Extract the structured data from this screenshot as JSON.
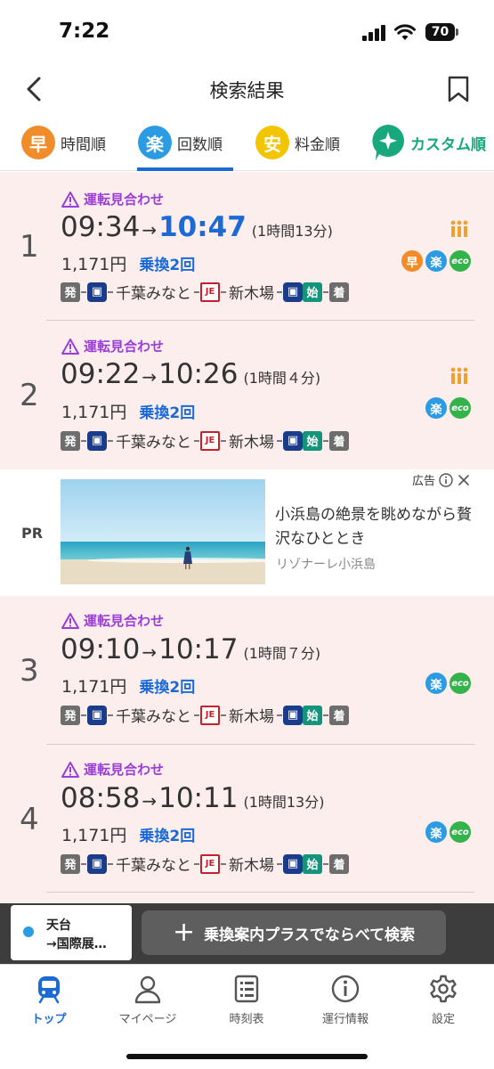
{
  "status_bar": {
    "time": "7:22",
    "battery": "70"
  },
  "header": {
    "title": "検索結果"
  },
  "tabs": [
    {
      "badge": "早",
      "label": "時間順",
      "color": "#f08c2a"
    },
    {
      "badge": "楽",
      "label": "回数順",
      "color": "#2b9be3"
    },
    {
      "badge": "安",
      "label": "料金順",
      "color": "#f2c500"
    },
    {
      "badge": "+",
      "label": "カスタム順",
      "color": "#17a87e"
    }
  ],
  "active_tab": "回数順",
  "results": [
    {
      "rank": "1",
      "notice": "運転見合わせ",
      "depart": "09:34",
      "arrow": "→",
      "arrive": "10:47",
      "duration": "(1時間13分)",
      "fare": "1,171円",
      "transfer": "乗換2回",
      "route": {
        "start": "発",
        "station1": "千葉みなと",
        "line": "JE",
        "station2": "新木場",
        "origin_mark": "始",
        "end": "着"
      },
      "tags": [
        "早",
        "楽",
        "eco"
      ]
    },
    {
      "rank": "2",
      "notice": "運転見合わせ",
      "depart": "09:22",
      "arrow": "→",
      "arrive": "10:26",
      "duration": "(1時間４分)",
      "fare": "1,171円",
      "transfer": "乗換2回",
      "route": {
        "start": "発",
        "station1": "千葉みなと",
        "line": "JE",
        "station2": "新木場",
        "origin_mark": "始",
        "end": "着"
      },
      "tags": [
        "楽",
        "eco"
      ]
    },
    {
      "rank": "3",
      "notice": "運転見合わせ",
      "depart": "09:10",
      "arrow": "→",
      "arrive": "10:17",
      "duration": "(1時間７分)",
      "fare": "1,171円",
      "transfer": "乗換2回",
      "route": {
        "start": "発",
        "station1": "千葉みなと",
        "line": "JE",
        "station2": "新木場",
        "origin_mark": "始",
        "end": "着"
      },
      "tags": [
        "楽",
        "eco"
      ]
    },
    {
      "rank": "4",
      "notice": "運転見合わせ",
      "depart": "08:58",
      "arrow": "→",
      "arrive": "10:11",
      "duration": "(1時間13分)",
      "fare": "1,171円",
      "transfer": "乗換2回",
      "route": {
        "start": "発",
        "station1": "千葉みなと",
        "line": "JE",
        "station2": "新木場",
        "origin_mark": "始",
        "end": "着"
      },
      "tags": [
        "楽",
        "eco"
      ]
    }
  ],
  "ad": {
    "pr_label": "PR",
    "ad_label": "広告",
    "title": "小浜島の絶景を眺めながら贅沢なひととき",
    "sponsor": "リゾナーレ小浜島"
  },
  "search_bar": {
    "from": "天台",
    "to": "→国際展…",
    "compare_label": "乗換案内プラスでならべて検索"
  },
  "bottom_nav": [
    {
      "label": "トップ",
      "icon": "train-icon",
      "active": true
    },
    {
      "label": "マイページ",
      "icon": "person-icon",
      "active": false
    },
    {
      "label": "時刻表",
      "icon": "timetable-icon",
      "active": false
    },
    {
      "label": "運行情報",
      "icon": "info-icon",
      "active": false
    },
    {
      "label": "設定",
      "icon": "gear-icon",
      "active": false
    }
  ],
  "colors": {
    "accent": "#1b6ad6",
    "warning": "#9b3dd6",
    "result_bg": "#fdeeee"
  }
}
